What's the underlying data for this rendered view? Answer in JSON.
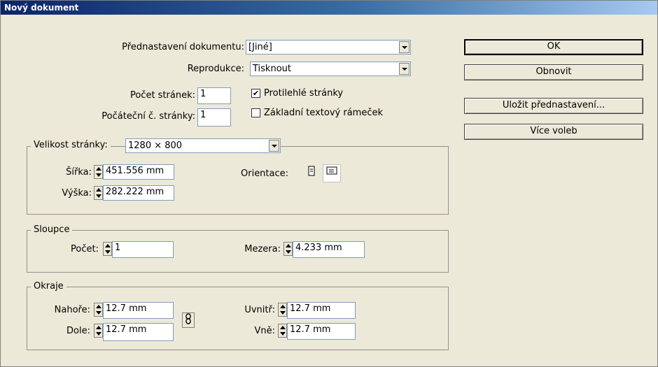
{
  "window": {
    "title": "Nový dokument"
  },
  "preset": {
    "label": "Přednastavení dokumentu:",
    "value": "[Jiné]"
  },
  "intent": {
    "label": "Reprodukce:",
    "value": "Tisknout"
  },
  "pages": {
    "count_label": "Počet stránek:",
    "count_value": "1",
    "start_label": "Počáteční č. stránky:",
    "start_value": "1"
  },
  "options": {
    "facing_pages": "Protilehlé stránky",
    "facing_checked": "✔",
    "master_text_frame": "Základní textový rámeček"
  },
  "page_size": {
    "label": "Velikost stránky:",
    "value": "1280 × 800",
    "width_label": "Šířka:",
    "width_value": "451.556 mm",
    "height_label": "Výška:",
    "height_value": "282.222 mm",
    "orientation_label": "Orientace:"
  },
  "columns": {
    "legend": "Sloupce",
    "count_label": "Počet:",
    "count_value": "1",
    "gutter_label": "Mezera:",
    "gutter_value": "4.233 mm"
  },
  "margins": {
    "legend": "Okraje",
    "top_label": "Nahoře:",
    "top_value": "12.7 mm",
    "bottom_label": "Dole:",
    "bottom_value": "12.7 mm",
    "inside_label": "Uvnitř:",
    "inside_value": "12.7 mm",
    "outside_label": "Vně:",
    "outside_value": "12.7 mm"
  },
  "buttons": {
    "ok": "OK",
    "reset": "Obnovit",
    "save_preset": "Uložit přednastavení...",
    "more_options": "Více voleb"
  }
}
